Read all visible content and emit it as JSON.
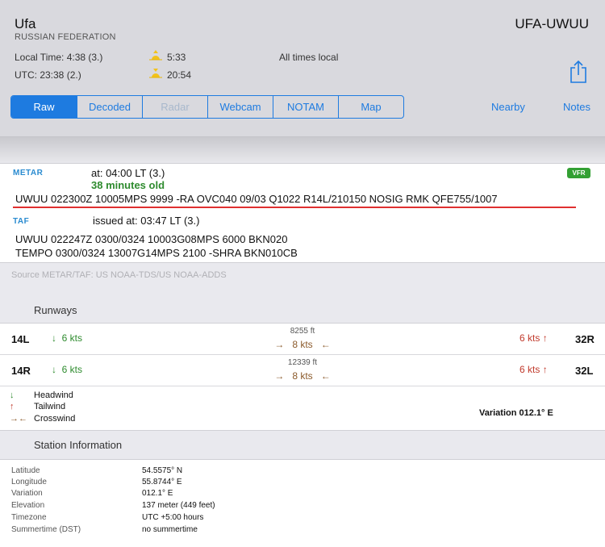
{
  "station": {
    "city": "Ufa",
    "country": "RUSSIAN FEDERATION",
    "code": "UFA-UWUU",
    "local_time": "Local Time: 4:38 (3.)",
    "utc_time": "UTC: 23:38 (2.)",
    "sunrise": "5:33",
    "sunset": "20:54",
    "all_times": "All times local"
  },
  "tabs": [
    {
      "label": "Raw",
      "state": "active"
    },
    {
      "label": "Decoded",
      "state": "normal"
    },
    {
      "label": "Radar",
      "state": "disabled"
    },
    {
      "label": "Webcam",
      "state": "normal"
    },
    {
      "label": "NOTAM",
      "state": "normal"
    },
    {
      "label": "Map",
      "state": "normal"
    }
  ],
  "actions": {
    "nearby": "Nearby",
    "notes": "Notes"
  },
  "metar": {
    "tag": "METAR",
    "at": "at: 04:00 LT (3.)",
    "age": "38 minutes old",
    "flight_rule": "VFR",
    "raw": "UWUU 022300Z 10005MPS 9999 -RA OVC040 09/03 Q1022 R14L/210150 NOSIG RMK QFE755/1007"
  },
  "taf": {
    "tag": "TAF",
    "issued": "issued at: 03:47 LT (3.)",
    "line1": "UWUU 022247Z 0300/0324 10003G08MPS 6000 BKN020",
    "line2": "TEMPO 0300/0324 13007G14MPS 2100 -SHRA BKN010CB"
  },
  "source": "Source METAR/TAF: US NOAA-TDS/US NOAA-ADDS",
  "runways": {
    "title": "Runways",
    "items": [
      {
        "name": "14L",
        "headwind": "6 kts",
        "length": "8255 ft",
        "crosswind": "8 kts",
        "tailwind": "6 kts",
        "opposite": "32R"
      },
      {
        "name": "14R",
        "headwind": "6 kts",
        "length": "12339 ft",
        "crosswind": "8 kts",
        "tailwind": "6 kts",
        "opposite": "32L"
      }
    ],
    "legend": {
      "headwind": "Headwind",
      "tailwind": "Tailwind",
      "crosswind": "Crosswind"
    },
    "variation": "Variation 012.1° E"
  },
  "station_info": {
    "title": "Station Information",
    "rows": [
      {
        "key": "Latitude",
        "value": "54.5575° N"
      },
      {
        "key": "Longitude",
        "value": "55.8744° E"
      },
      {
        "key": "Variation",
        "value": "012.1° E"
      },
      {
        "key": "Elevation",
        "value": "137 meter (449 feet)"
      },
      {
        "key": "Timezone",
        "value": "UTC +5:00 hours"
      },
      {
        "key": "Summertime (DST)",
        "value": "no summertime"
      }
    ]
  },
  "colors": {
    "accent": "#1e7be0",
    "headwind": "#2e8b2e",
    "tailwind": "#c0392b",
    "crosswind": "#8b5a2b",
    "underline": "#e03030"
  }
}
